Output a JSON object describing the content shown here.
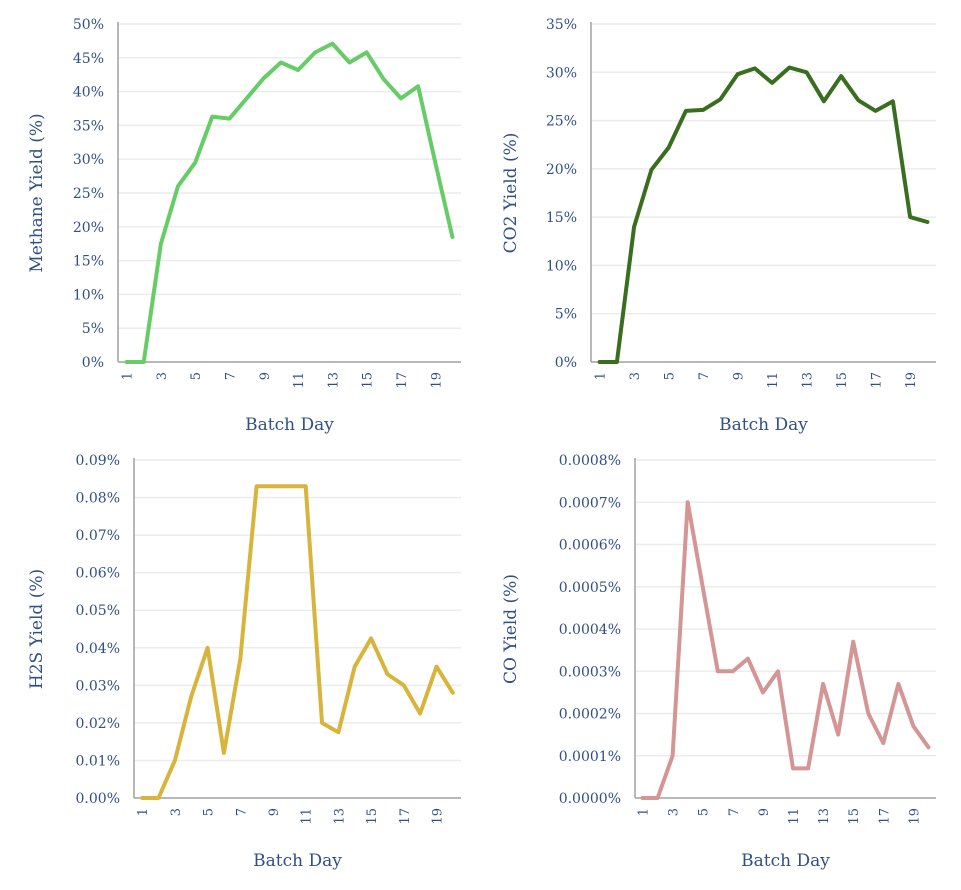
{
  "colors": {
    "text": "#2f4f86",
    "grid": "#ececec",
    "axis": "#a0a0a0"
  },
  "chart_data": [
    {
      "type": "line",
      "id": "methane",
      "title": "",
      "xlabel": "Batch Day",
      "ylabel": "Methane Yield (%)",
      "x": [
        1,
        2,
        3,
        4,
        5,
        6,
        7,
        8,
        9,
        10,
        11,
        12,
        13,
        14,
        15,
        16,
        17,
        18,
        19,
        20
      ],
      "x_tick_labels": [
        "1",
        "3",
        "5",
        "7",
        "9",
        "11",
        "13",
        "15",
        "17",
        "19"
      ],
      "y_tick_labels": [
        "0%",
        "5%",
        "10%",
        "15%",
        "20%",
        "25%",
        "30%",
        "35%",
        "40%",
        "45%",
        "50%"
      ],
      "ylim": [
        0,
        50
      ],
      "grid": true,
      "series": [
        {
          "name": "Methane Yield",
          "color": "#66cc66",
          "values": [
            0,
            0,
            17.5,
            26,
            29.5,
            36.3,
            36,
            39,
            42,
            44.3,
            43.2,
            45.8,
            47.1,
            44.3,
            45.8,
            41.8,
            39,
            40.8,
            29.5,
            18.5
          ]
        }
      ]
    },
    {
      "type": "line",
      "id": "co2",
      "title": "",
      "xlabel": "Batch Day",
      "ylabel": "CO2 Yield (%)",
      "x": [
        1,
        2,
        3,
        4,
        5,
        6,
        7,
        8,
        9,
        10,
        11,
        12,
        13,
        14,
        15,
        16,
        17,
        18,
        19,
        20
      ],
      "x_tick_labels": [
        "1",
        "3",
        "5",
        "7",
        "9",
        "11",
        "13",
        "15",
        "17",
        "19"
      ],
      "y_tick_labels": [
        "0%",
        "5%",
        "10%",
        "15%",
        "20%",
        "25%",
        "30%",
        "35%"
      ],
      "ylim": [
        0,
        35
      ],
      "grid": true,
      "series": [
        {
          "name": "CO2 Yield",
          "color": "#3a6e1f",
          "values": [
            0,
            0,
            14,
            19.9,
            22.2,
            26,
            26.1,
            27.2,
            29.8,
            30.4,
            28.9,
            30.5,
            30,
            27,
            29.6,
            27.1,
            26,
            27,
            15,
            14.5
          ]
        }
      ]
    },
    {
      "type": "line",
      "id": "h2s",
      "title": "",
      "xlabel": "Batch Day",
      "ylabel": "H2S Yield (%)",
      "x": [
        1,
        2,
        3,
        4,
        5,
        6,
        7,
        8,
        9,
        10,
        11,
        12,
        13,
        14,
        15,
        16,
        17,
        18,
        19,
        20
      ],
      "x_tick_labels": [
        "1",
        "3",
        "5",
        "7",
        "9",
        "11",
        "13",
        "15",
        "17",
        "19"
      ],
      "y_tick_labels": [
        "0.00%",
        "0.01%",
        "0.02%",
        "0.03%",
        "0.04%",
        "0.05%",
        "0.06%",
        "0.07%",
        "0.08%",
        "0.09%"
      ],
      "ylim": [
        0,
        0.09
      ],
      "grid": true,
      "series": [
        {
          "name": "H2S Yield",
          "color": "#d9b43c",
          "values": [
            0,
            0,
            0.01,
            0.027,
            0.04,
            0.012,
            0.037,
            0.083,
            0.083,
            0.083,
            0.083,
            0.02,
            0.0175,
            0.035,
            0.0425,
            0.033,
            0.03,
            0.0225,
            0.035,
            0.028
          ]
        }
      ]
    },
    {
      "type": "line",
      "id": "co",
      "title": "",
      "xlabel": "Batch Day",
      "ylabel": "CO Yield (%)",
      "x": [
        1,
        2,
        3,
        4,
        5,
        6,
        7,
        8,
        9,
        10,
        11,
        12,
        13,
        14,
        15,
        16,
        17,
        18,
        19,
        20
      ],
      "x_tick_labels": [
        "1",
        "3",
        "5",
        "7",
        "9",
        "11",
        "13",
        "15",
        "17",
        "19"
      ],
      "y_tick_labels": [
        "0.0000%",
        "0.0001%",
        "0.0002%",
        "0.0003%",
        "0.0004%",
        "0.0005%",
        "0.0006%",
        "0.0007%",
        "0.0008%"
      ],
      "ylim": [
        0,
        0.0008
      ],
      "grid": true,
      "series": [
        {
          "name": "CO Yield",
          "color": "#d49595",
          "values": [
            0,
            0,
            0.0001,
            0.0007,
            0.0005,
            0.0003,
            0.0003,
            0.00033,
            0.00025,
            0.0003,
            7e-05,
            7e-05,
            0.00027,
            0.00015,
            0.00037,
            0.0002,
            0.00013,
            0.00027,
            0.00017,
            0.00012
          ]
        }
      ]
    }
  ]
}
